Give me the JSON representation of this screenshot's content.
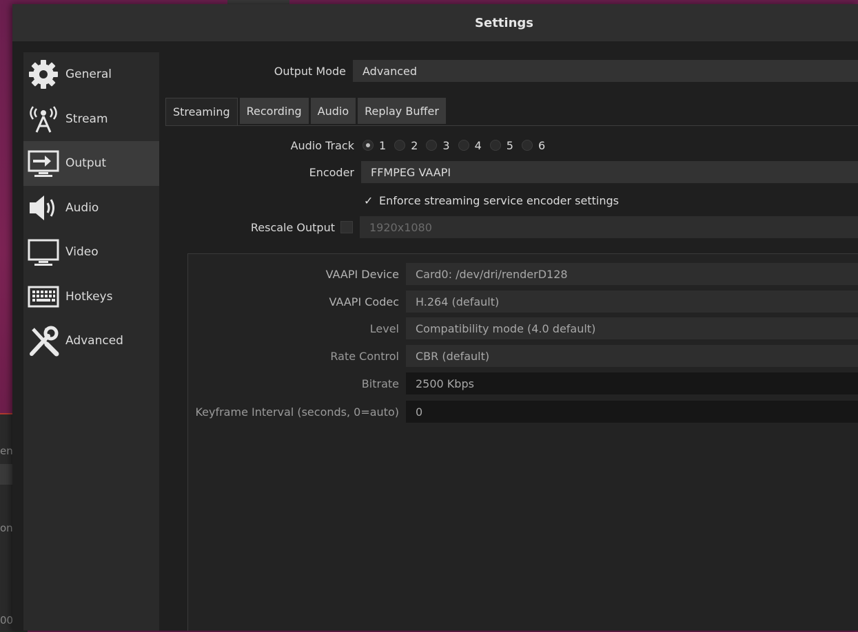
{
  "dialog": {
    "title": "Settings"
  },
  "background": {
    "text_1": "en",
    "text_2": "on",
    "text_3": "00"
  },
  "sidebar": {
    "items": [
      {
        "label": "General",
        "icon": "gear-icon"
      },
      {
        "label": "Stream",
        "icon": "broadcast-antenna-icon"
      },
      {
        "label": "Output",
        "icon": "monitor-output-icon"
      },
      {
        "label": "Audio",
        "icon": "speaker-icon"
      },
      {
        "label": "Video",
        "icon": "monitor-icon"
      },
      {
        "label": "Hotkeys",
        "icon": "keyboard-icon"
      },
      {
        "label": "Advanced",
        "icon": "wrench-screwdriver-icon"
      }
    ],
    "active": "Output"
  },
  "output_mode": {
    "label": "Output Mode",
    "value": "Advanced"
  },
  "tabs": [
    "Streaming",
    "Recording",
    "Audio",
    "Replay Buffer"
  ],
  "active_tab": "Streaming",
  "audio_track": {
    "label": "Audio Track",
    "options": [
      "1",
      "2",
      "3",
      "4",
      "5",
      "6"
    ],
    "selected": "1"
  },
  "encoder": {
    "label": "Encoder",
    "value": "FFMPEG VAAPI"
  },
  "enforce": {
    "label": "Enforce streaming service encoder settings",
    "checked": true,
    "check_glyph": "✓"
  },
  "rescale": {
    "label": "Rescale Output",
    "checked": false,
    "value": "1920x1080"
  },
  "vaapi": {
    "device": {
      "label": "VAAPI Device",
      "value": "Card0: /dev/dri/renderD128"
    },
    "codec": {
      "label": "VAAPI Codec",
      "value": "H.264 (default)"
    },
    "level": {
      "label": "Level",
      "value": "Compatibility mode  (4.0 default)"
    },
    "rate_control": {
      "label": "Rate Control",
      "value": "CBR (default)"
    },
    "bitrate": {
      "label": "Bitrate",
      "value": "2500 Kbps"
    },
    "keyframe": {
      "label": "Keyframe Interval (seconds, 0=auto)",
      "value": "0"
    }
  }
}
